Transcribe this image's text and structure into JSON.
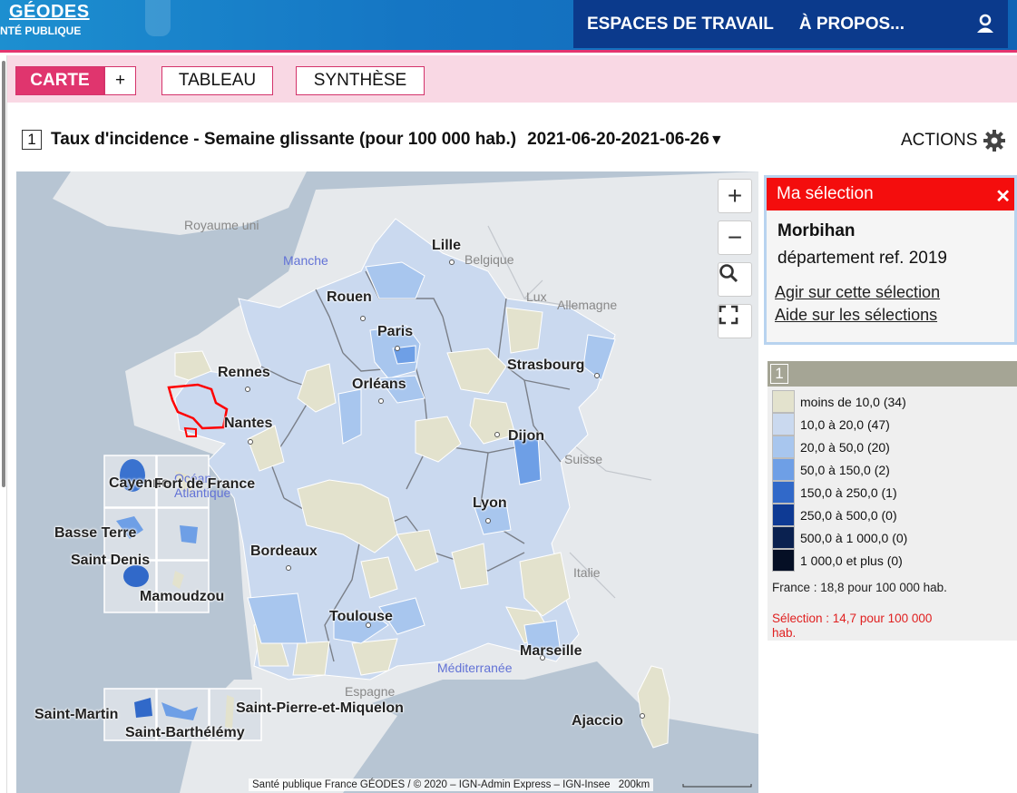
{
  "header": {
    "brand_line1": "GÉODES",
    "brand_line2": "NTÉ PUBLIQUE",
    "nav": [
      "ESPACES DE TRAVAIL",
      "À PROPOS..."
    ],
    "user_icon": "user-icon"
  },
  "tabs": {
    "carte": "CARTE",
    "plus": "+",
    "tableau": "TABLEAU",
    "synthese": "SYNTHÈSE"
  },
  "indicator": {
    "number": "1",
    "title": "Taux d'incidence - Semaine glissante (pour 100 000 hab.)",
    "period": "2021-06-20-2021-06-26",
    "caret": "▼",
    "actions": "ACTIONS",
    "actions_icon": "gear-icon"
  },
  "map": {
    "controls": [
      "+",
      "−"
    ],
    "control_icons": [
      "search-icon",
      "fullscreen-icon"
    ],
    "countries": [
      "Royaume uni",
      "Belgique",
      "Lux",
      "Allemagne",
      "Suisse",
      "Italie",
      "Espagne"
    ],
    "seas": [
      "Manche",
      "Océan Atlantique",
      "Méditerranée"
    ],
    "cities": [
      "Lille",
      "Rouen",
      "Paris",
      "Rennes",
      "Orléans",
      "Strasbourg",
      "Nantes",
      "Dijon",
      "Lyon",
      "Bordeaux",
      "Toulouse",
      "Marseille",
      "Ajaccio"
    ],
    "overseas": {
      "cayenne": "Cayenne",
      "fort_de_france": "Fort de France",
      "basse_terre": "Basse Terre",
      "saint_denis": "Saint Denis",
      "mamoudzou": "Mamoudzou",
      "saint_martin": "Saint-Martin",
      "saint_barthelemy": "Saint-Barthélémy",
      "saint_pierre": "Saint-Pierre-et-Miquelon"
    },
    "attribution": "Santé publique France GÉODES / © 2020 – IGN-Admin Express – IGN-Insee",
    "scale": "200km",
    "highlight_color": "#ff0000"
  },
  "selection": {
    "header": "Ma sélection",
    "close": "✕",
    "name": "Morbihan",
    "type": "département ref. 2019",
    "links": [
      "Agir sur cette sélection",
      "Aide sur les sélections"
    ],
    "accent": "#f40d0d"
  },
  "legend": {
    "number": "1",
    "classes": [
      {
        "label": "moins de 10,0 (34)",
        "color": "#e3e2cd"
      },
      {
        "label": "10,0 à 20,0 (47)",
        "color": "#cad9ef"
      },
      {
        "label": "20,0 à 50,0 (20)",
        "color": "#a8c6ee"
      },
      {
        "label": "50,0 à 150,0 (2)",
        "color": "#6e9fe6"
      },
      {
        "label": "150,0 à 250,0 (1)",
        "color": "#3169c9"
      },
      {
        "label": "250,0 à 500,0 (0)",
        "color": "#0e3a94"
      },
      {
        "label": "500,0 à 1 000,0 (0)",
        "color": "#0a2150"
      },
      {
        "label": "1 000,0 et plus (0)",
        "color": "#050f25"
      }
    ],
    "france_value": "France : 18,8 pour 100 000 hab.",
    "selection_value": "Sélection : 14,7 pour 100 000 hab."
  }
}
